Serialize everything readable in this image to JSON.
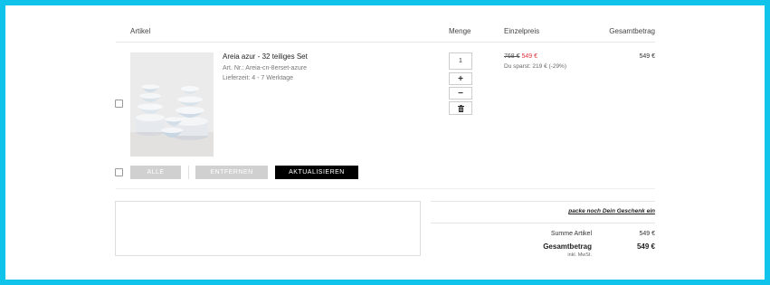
{
  "table": {
    "headers": {
      "article": "Artikel",
      "quantity": "Menge",
      "unit_price": "Einzelpreis",
      "total": "Gesamtbetrag"
    }
  },
  "item": {
    "name": "Areia azur - 32 teiliges Set",
    "sku_label": "Art. Nr.: Areia-cn-8erset-azure",
    "delivery": "Lieferzeit: 4 - 7 Werktage",
    "quantity": "1",
    "old_price": "768 €",
    "price": "549 €",
    "savings": "Du sparst: 219 € (-29%)",
    "line_total": "549 €",
    "image_icon": "dinnerware-set-photo"
  },
  "actions": {
    "all_label": "ALLE",
    "remove_label": "ENTFERNEN",
    "update_label": "AKTUALISIEREN"
  },
  "gift_link": "packe noch Dein Geschenk ein",
  "summary": {
    "subtotal_label": "Summe Artikel",
    "subtotal_value": "549 €",
    "total_label": "Gesamtbetrag",
    "total_value": "549 €",
    "vat_note": "inkl. MwSt."
  },
  "colors": {
    "frame": "#0fc3ea",
    "sale_price": "#d9363e",
    "primary_button": "#000000",
    "secondary_button": "#d0d0d0"
  }
}
